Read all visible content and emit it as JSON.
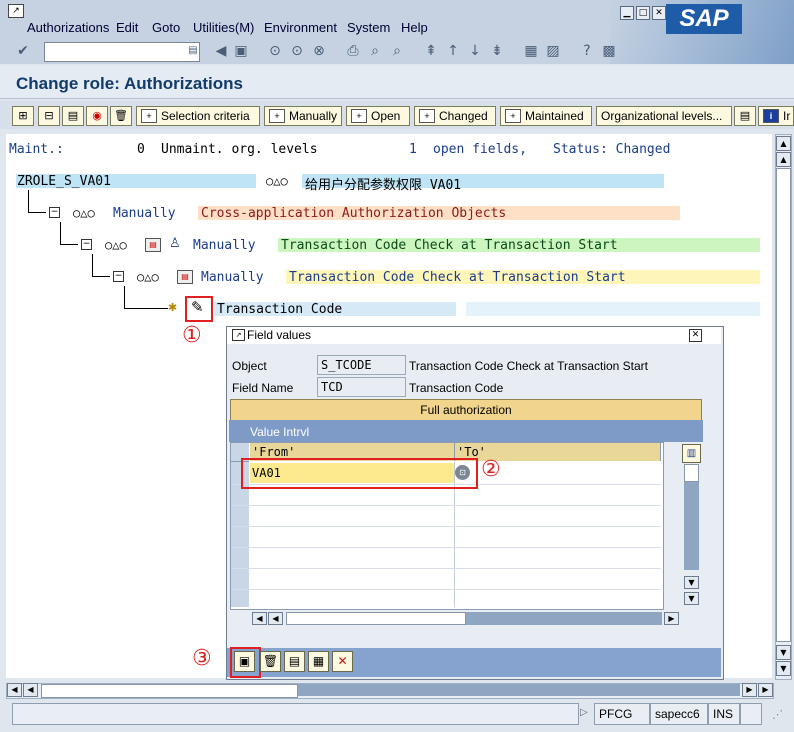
{
  "menu": {
    "items": [
      "Authorizations",
      "Edit",
      "Goto",
      "Utilities(M)",
      "Environment",
      "System",
      "Help"
    ]
  },
  "brand": {
    "logo_text": "SAP"
  },
  "page": {
    "title": "Change role: Authorizations"
  },
  "app_toolbar": {
    "selection_criteria": "Selection criteria",
    "manually": "Manually",
    "open": "Open",
    "changed": "Changed",
    "maintained": "Maintained",
    "org_levels": "Organizational levels...",
    "info_partial": "Ir"
  },
  "summary": {
    "maint_label": "Maint.:",
    "maint_count": "0",
    "unmaint_label": "Unmaint. org. levels",
    "open_count": "1",
    "open_label": "open fields,",
    "status_text": "Status: Changed"
  },
  "tree": {
    "root_id": "ZROLE_S_VA01",
    "root_desc": "给用户分配参数权限 VA01",
    "level1_state": "Manually",
    "level1_text": "Cross-application Authorization Objects",
    "level2_state": "Manually",
    "level2_text": "Transaction Code Check at Transaction Start",
    "level3_state": "Manually",
    "level3_text": "Transaction Code Check at Transaction Start",
    "field_text": "Transaction Code"
  },
  "dialog": {
    "title": "Field values",
    "object_label": "Object",
    "object_value": "S_TCODE",
    "object_desc": "Transaction Code Check at Transaction Start",
    "fieldname_label": "Field Name",
    "fieldname_value": "TCD",
    "fieldname_desc": "Transaction Code",
    "full_auth": "Full authorization",
    "value_intrvl": "Value Intrvl",
    "col_from": "'From'",
    "col_to": "'To'",
    "row1_from": "VA01",
    "row1_to": ""
  },
  "annotations": {
    "one": "①",
    "two": "②",
    "three": "③"
  },
  "statusbar": {
    "tcode": "PFCG",
    "system": "sapecc6",
    "mode": "INS"
  },
  "colors": {
    "accent_red": "#e02020",
    "title_blue": "#123b6b",
    "tree_blue": "#1b3c8c"
  }
}
